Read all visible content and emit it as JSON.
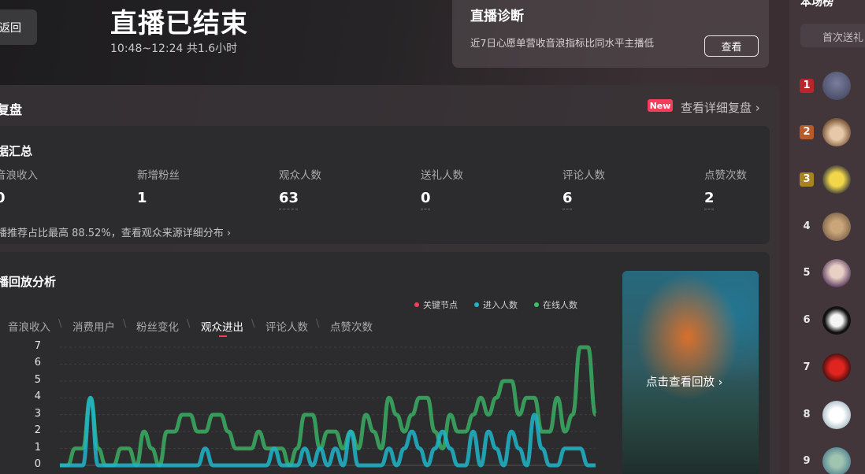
{
  "header": {
    "back_label": "返回",
    "title": "直播已结束",
    "time_info": "10:48~12:24 共1.6小时"
  },
  "diagnosis": {
    "title": "直播诊断",
    "description": "近7日心愿单营收音浪指标比同水平主播低",
    "button_label": "查看"
  },
  "review": {
    "title": "复盘",
    "new_badge": "New",
    "link_label": "查看详细复盘 ›"
  },
  "summary": {
    "title": "据汇总",
    "metrics": [
      {
        "label": "音浪收入",
        "value": "0"
      },
      {
        "label": "新增粉丝",
        "value": "1"
      },
      {
        "label": "观众人数",
        "value": "63"
      },
      {
        "label": "送礼人数",
        "value": "0"
      },
      {
        "label": "评论人数",
        "value": "6"
      },
      {
        "label": "点赞次数",
        "value": "2"
      }
    ],
    "note": "播推荐占比最高 88.52%，查看观众来源详细分布 ›"
  },
  "analysis": {
    "title": "播回放分析",
    "legend": [
      {
        "label": "关键节点",
        "color": "#f33d5b"
      },
      {
        "label": "进入人数",
        "color": "#1fb5c9"
      },
      {
        "label": "在线人数",
        "color": "#3cc069"
      }
    ],
    "tabs": [
      "音浪收入",
      "消费用户",
      "粉丝变化",
      "观众进出",
      "评论人数",
      "点赞次数"
    ],
    "active_tab": "观众进出"
  },
  "chart_data": {
    "type": "line",
    "y_ticks": [
      "0",
      "1",
      "2",
      "3",
      "4",
      "5",
      "6",
      "7"
    ],
    "ylim": [
      0,
      7
    ],
    "x": [
      0,
      1,
      2,
      3,
      4,
      5,
      6,
      7,
      8,
      9,
      10,
      11,
      12,
      13,
      14,
      15,
      16,
      17,
      18,
      19,
      20,
      21,
      22,
      23,
      24,
      25,
      26,
      27,
      28,
      29,
      30,
      31,
      32,
      33,
      34,
      35,
      36,
      37,
      38,
      39,
      40,
      41,
      42,
      43,
      44,
      45,
      46,
      47,
      48,
      49,
      50,
      51,
      52,
      53,
      54,
      55,
      56,
      57,
      58,
      59,
      60,
      61,
      62,
      63,
      64,
      65,
      66,
      67,
      68,
      69,
      70
    ],
    "series": [
      {
        "name": "在线人数",
        "color": "#3cc069",
        "values": [
          0,
          0,
          1,
          1,
          4,
          1,
          0,
          0,
          1,
          1,
          0,
          2,
          1,
          0,
          2,
          2,
          3,
          3,
          2,
          2,
          3,
          3,
          2,
          1,
          1,
          1,
          2,
          1,
          1,
          1,
          0,
          1,
          3,
          3,
          1,
          2,
          2,
          1,
          2,
          1,
          3,
          2,
          1,
          4,
          3,
          2,
          3,
          4,
          4,
          2,
          1,
          3,
          2,
          2,
          3,
          4,
          3,
          4,
          5,
          5,
          3,
          4,
          4,
          2,
          2,
          4,
          2,
          3,
          7,
          7,
          3
        ]
      },
      {
        "name": "进入人数",
        "color": "#1fb5c9",
        "values": [
          0,
          0,
          0,
          0,
          4,
          0,
          0,
          0,
          0,
          0,
          0,
          0,
          0,
          0,
          0,
          0,
          0,
          0,
          0,
          1,
          0,
          0,
          0,
          0,
          0,
          0,
          0,
          0,
          1,
          0,
          0,
          0,
          1,
          0,
          1,
          0,
          1,
          0,
          2,
          0,
          0,
          0,
          0,
          1,
          0,
          1,
          2,
          1,
          0,
          1,
          2,
          1,
          0,
          0,
          2,
          0,
          2,
          1,
          0,
          2,
          1,
          0,
          3,
          1,
          0,
          0,
          1,
          1,
          1,
          0,
          0
        ]
      }
    ]
  },
  "replay": {
    "label": "点击查看回放 ›"
  },
  "ranking": {
    "title": "本场榜",
    "tab_label": "首次送礼",
    "items": [
      {
        "rank": "1"
      },
      {
        "rank": "2"
      },
      {
        "rank": "3"
      },
      {
        "rank": "4"
      },
      {
        "rank": "5"
      },
      {
        "rank": "6"
      },
      {
        "rank": "7"
      },
      {
        "rank": "8"
      },
      {
        "rank": "9"
      }
    ]
  }
}
